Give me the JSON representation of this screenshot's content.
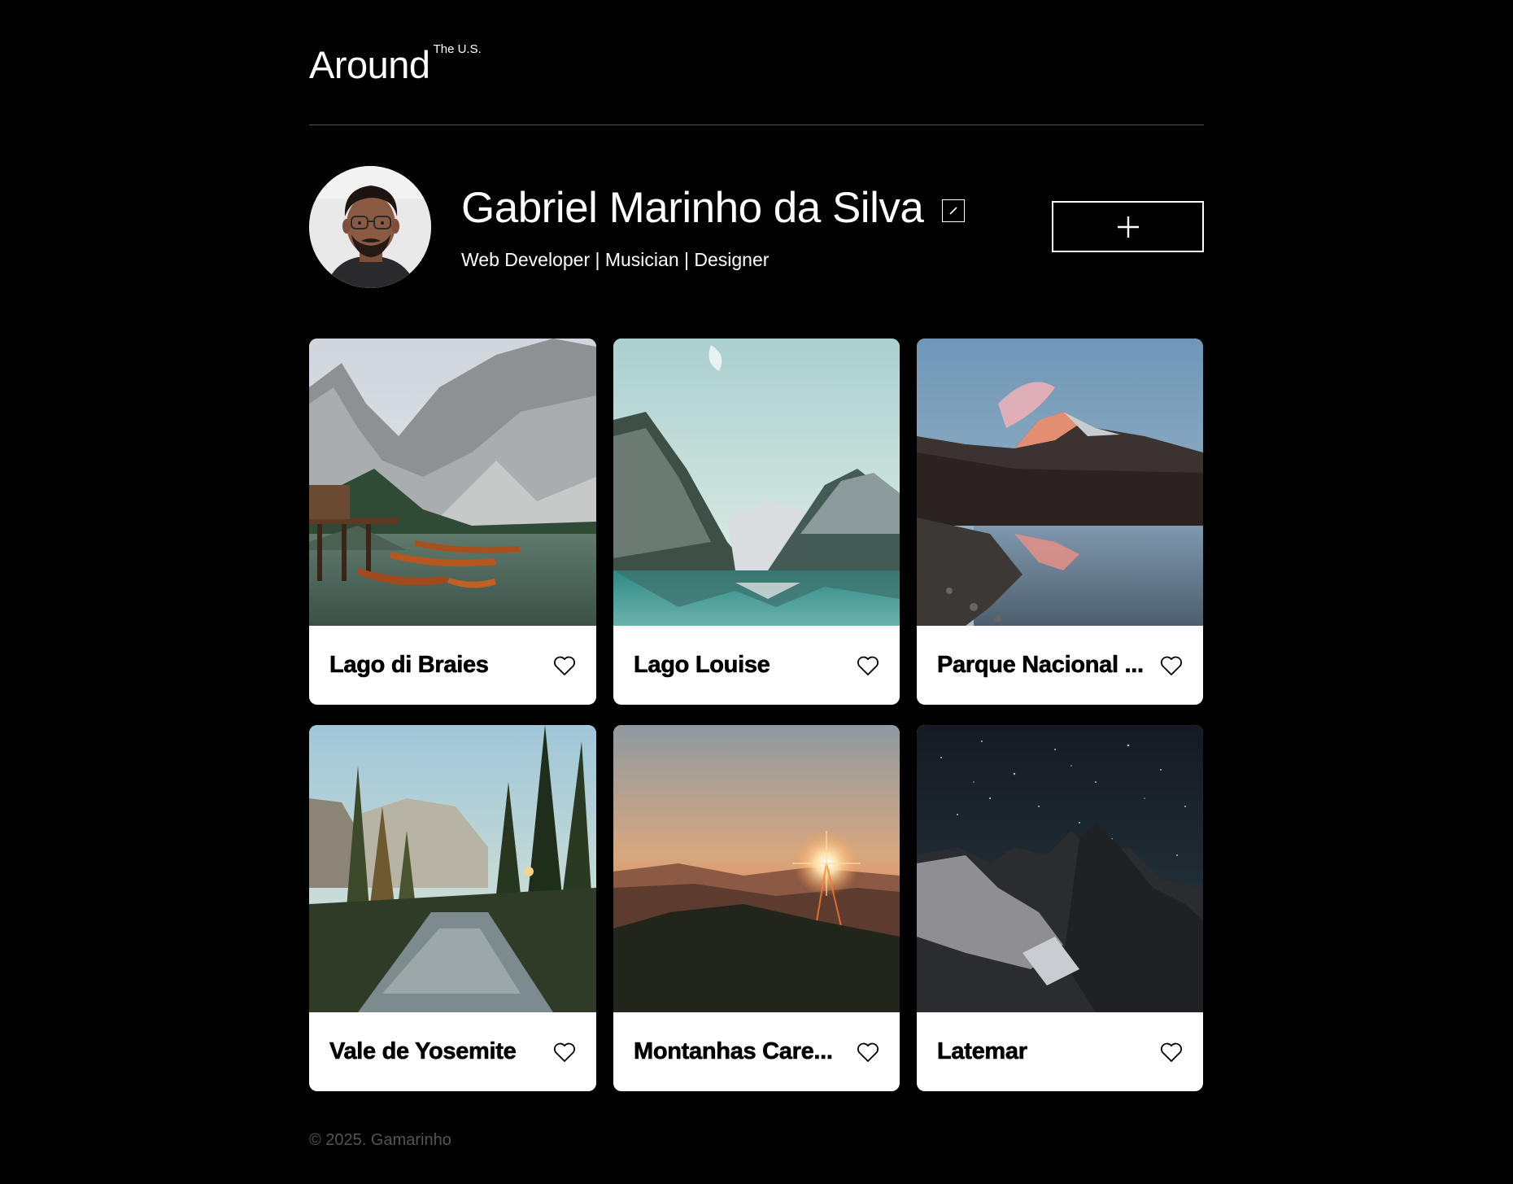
{
  "header": {
    "logo_main": "Around",
    "logo_sup": "The U.S."
  },
  "profile": {
    "name": "Gabriel Marinho da Silva",
    "description": "Web Developer | Musician | Designer",
    "edit_icon": "pencil-icon",
    "add_icon": "plus-icon"
  },
  "cards": [
    {
      "title": "Lago di Braies",
      "scene": "lake-boats-mountains",
      "like_icon": "heart-outline-icon"
    },
    {
      "title": "Lago Louise",
      "scene": "turquoise-lake-valley",
      "like_icon": "heart-outline-icon"
    },
    {
      "title": "Parque Nacional ...",
      "scene": "mountain-reflection-dusk",
      "like_icon": "heart-outline-icon"
    },
    {
      "title": "Vale de Yosemite",
      "scene": "river-forest-valley",
      "like_icon": "heart-outline-icon"
    },
    {
      "title": "Montanhas Care...",
      "scene": "sunset-over-hills",
      "like_icon": "heart-outline-icon"
    },
    {
      "title": "Latemar",
      "scene": "starry-night-peaks",
      "like_icon": "heart-outline-icon"
    }
  ],
  "footer": {
    "copyright": "© 2025. Gamarinho"
  },
  "colors": {
    "background": "#000000",
    "text": "#ffffff",
    "divider": "#545454",
    "card": "#ffffff",
    "footer_text": "#545454"
  }
}
